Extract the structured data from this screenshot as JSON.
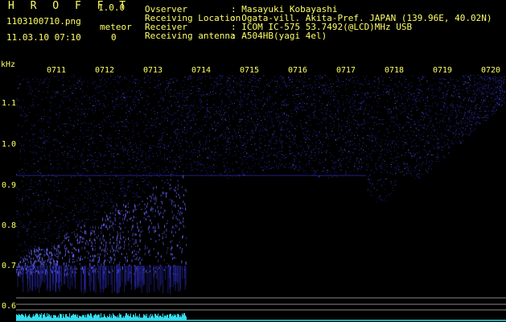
{
  "header": {
    "app_title": "H R O F F T",
    "version": "1.0.0",
    "filename": "1103100710.png",
    "datetime": "11.03.10 07:10",
    "meteor_label": "meteor",
    "meteor_count": "0"
  },
  "station": {
    "rows": [
      {
        "label": "Ovserver",
        "value": ": Masayuki Kobayashi"
      },
      {
        "label": "Receiving Location",
        "value": ": Ogata-vill. Akita-Pref. JAPAN (139.96E, 40.02N)"
      },
      {
        "label": "Receiver",
        "value": ": ICOM IC-575 53.7492(@LCD)MHz USB"
      },
      {
        "label": "Receiving antenna",
        "value": ": A504HB(yagi 4el)"
      }
    ]
  },
  "spectrogram": {
    "freq_unit": "kHz",
    "freq_ticks": [
      "1.1",
      "1.0",
      "0.9",
      "0.8",
      "0.7",
      "0.6"
    ],
    "time_ticks": [
      "0711",
      "0712",
      "0713",
      "0714",
      "0715",
      "0716",
      "0717",
      "0718",
      "0719",
      "0720"
    ],
    "colors": {
      "noise": "#2a2aaa",
      "signal": "#6666ff",
      "grid": "#888888",
      "level": "#33ddee",
      "text": "#ffff66"
    }
  }
}
